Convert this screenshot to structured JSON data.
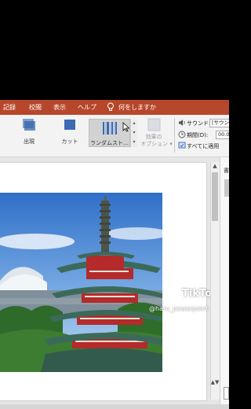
{
  "tabs": [
    "記録",
    "校閲",
    "表示",
    "ヘルプ"
  ],
  "tell_me": "何をしますか",
  "ribbon": {
    "transitions": [
      {
        "label": "出現",
        "icon": "appear-transition-icon",
        "selected": false
      },
      {
        "label": "カット",
        "icon": "cut-transition-icon",
        "selected": false
      },
      {
        "label": "ランダムスト…",
        "icon": "random-bars-transition-icon",
        "selected": true
      }
    ],
    "effect_options_line1": "効果の",
    "effect_options_line2": "オプション",
    "effect_options_arrow": "▾",
    "gallery_scroll": [
      "▴",
      "▾",
      "▾"
    ],
    "sound_label": "サウンド:",
    "sound_value": "[サウンド",
    "duration_label": "期間(D):",
    "duration_value": "00.0",
    "apply_all_label": "すべてに適用"
  },
  "watermark": {
    "brand": "TikTok",
    "handle": "@haru_powerpoint"
  },
  "scrollbar": {
    "up_arrow": "▲",
    "down_arrows": "▲▼"
  },
  "right_panel_char": "書"
}
